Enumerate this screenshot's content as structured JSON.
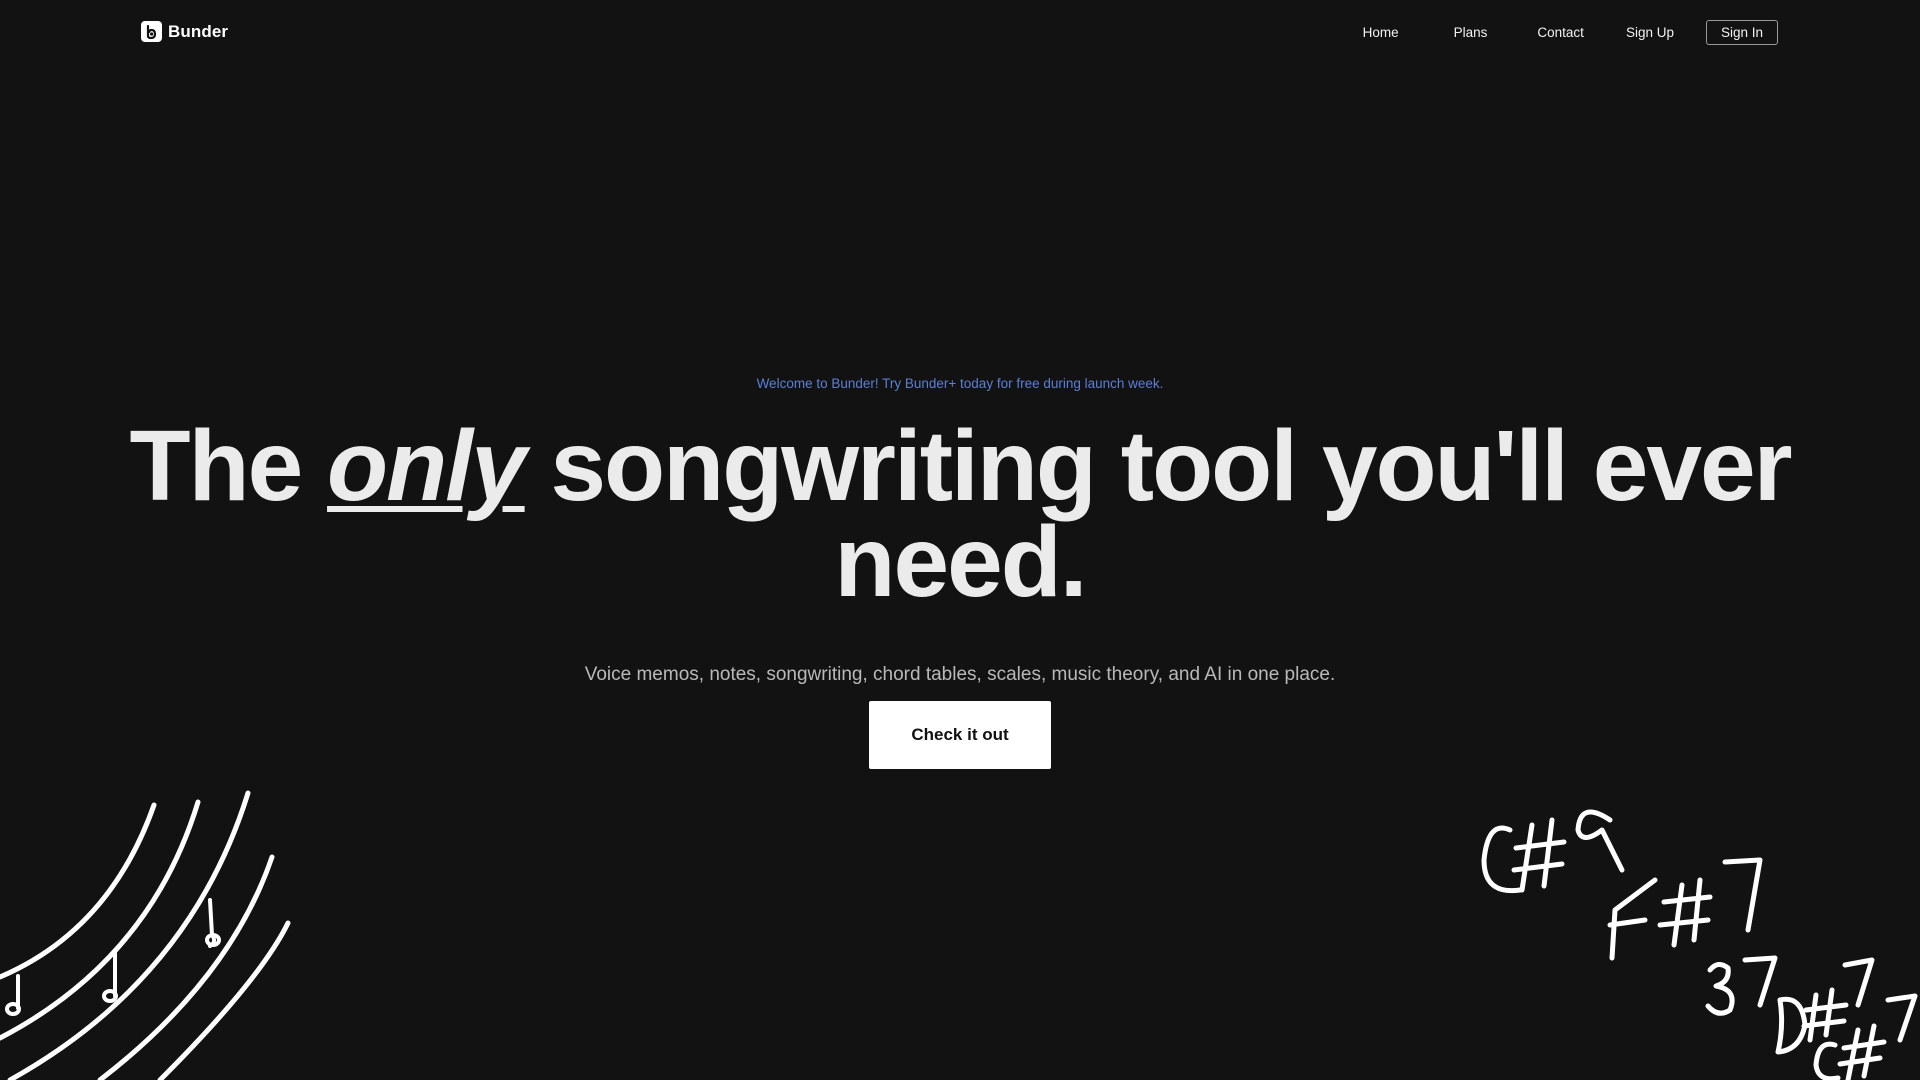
{
  "brand": {
    "name": "Bunder",
    "logo_icon": "bunder-logo-icon"
  },
  "nav": {
    "home": "Home",
    "plans": "Plans",
    "contact": "Contact",
    "sign_up": "Sign Up",
    "sign_in": "Sign In"
  },
  "hero": {
    "announcement": "Welcome to Bunder! Try Bunder+ today for free during launch week.",
    "headline_before": "The ",
    "headline_emphasis": "only",
    "headline_after": " songwriting tool you'll ever need.",
    "subtitle": "Voice memos, notes, songwriting, chord tables, scales, music theory, and AI in one place.",
    "cta_label": "Check it out"
  },
  "decorations": {
    "left": "music-staff-doodle",
    "right_chords": [
      "C#9",
      "F#7",
      "B7",
      "D#7",
      "C#7"
    ]
  },
  "colors": {
    "background": "#121212",
    "accent": "#5b7fd6",
    "text": "#ebebeb",
    "subtitle": "#b9b9b9",
    "cta_bg": "#ffffff"
  }
}
